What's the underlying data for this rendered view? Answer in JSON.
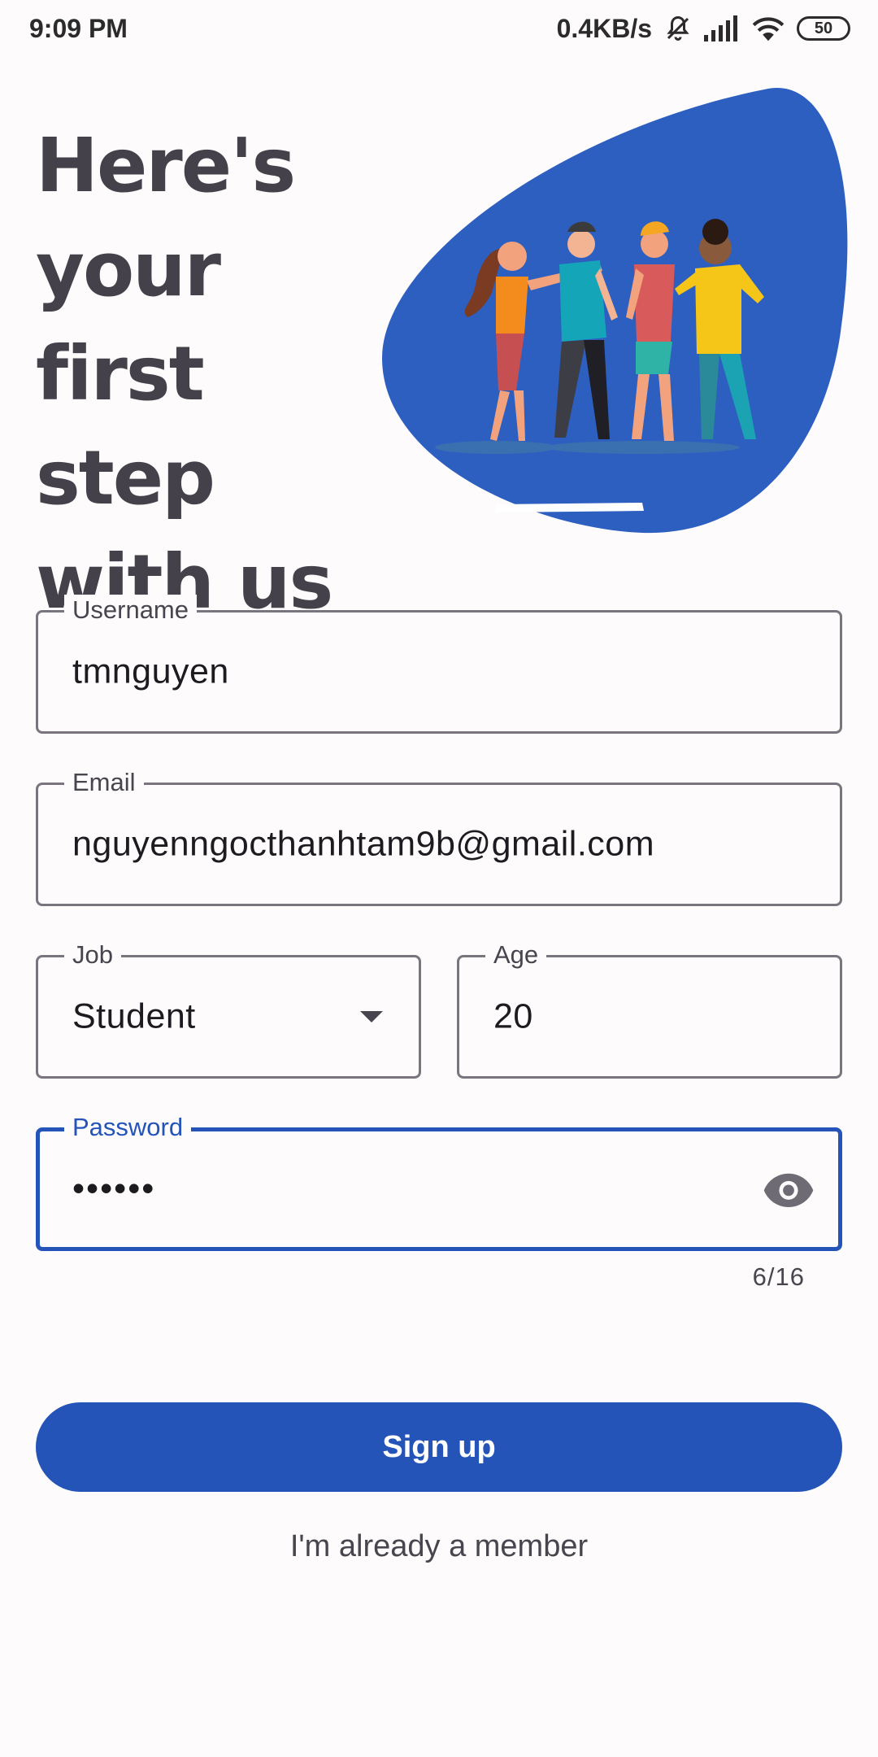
{
  "status_bar": {
    "time": "9:09 PM",
    "net_speed": "0.4KB/s",
    "battery": "50"
  },
  "hero": {
    "title": "Here's your first step with us",
    "accent_color": "#2d5fc0"
  },
  "form": {
    "username": {
      "label": "Username",
      "value": "tmnguyen"
    },
    "email": {
      "label": "Email",
      "value": "nguyenngocthanhtam9b@gmail.com"
    },
    "job": {
      "label": "Job",
      "value": "Student"
    },
    "age": {
      "label": "Age",
      "value": "20"
    },
    "password": {
      "label": "Password",
      "value": "••••••",
      "counter": "6/16"
    }
  },
  "actions": {
    "signup_label": "Sign up",
    "member_label": "I'm already a member",
    "primary_color": "#2454b8"
  }
}
